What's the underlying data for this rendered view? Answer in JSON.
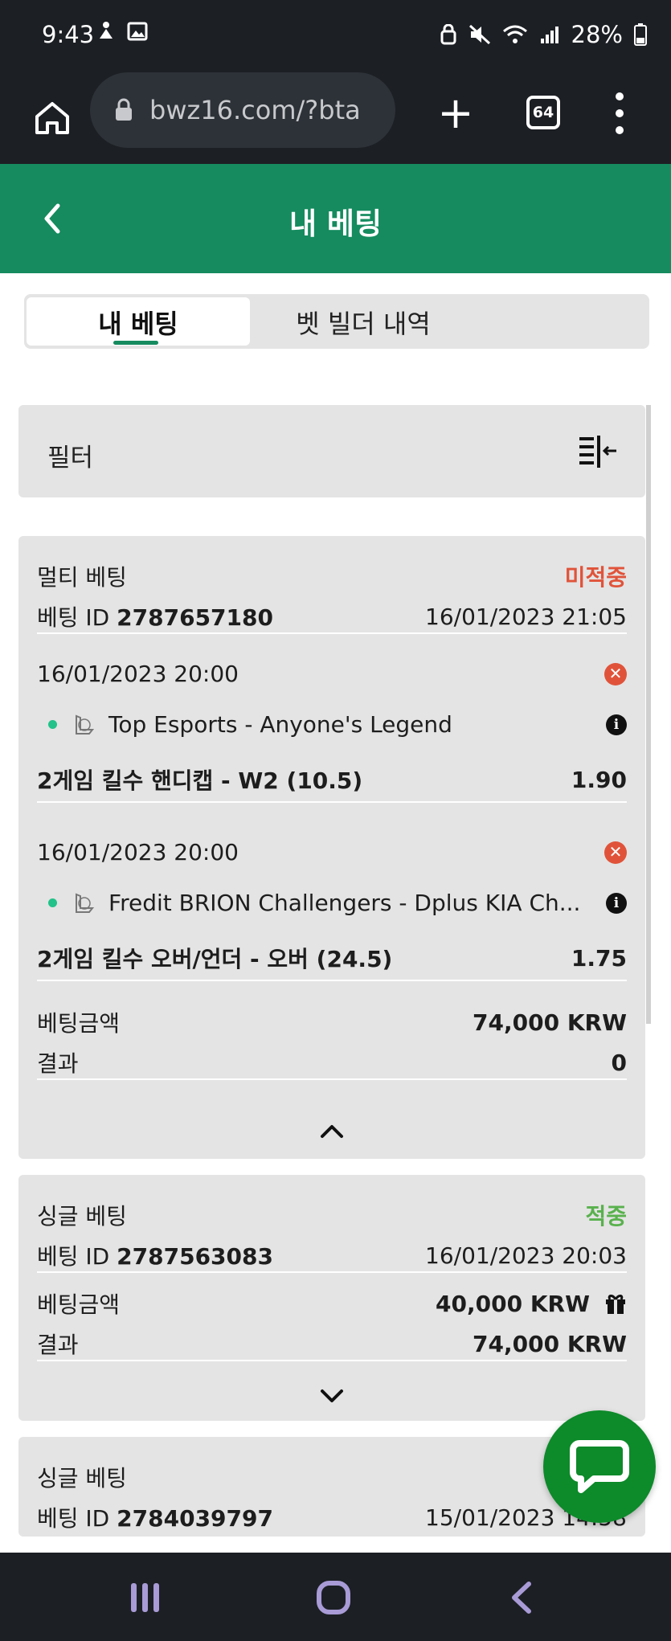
{
  "status_bar": {
    "time": "9:43",
    "battery": "28%"
  },
  "browser": {
    "url": "bwz16.com/?bta",
    "tab_count": "64"
  },
  "header": {
    "title": "내 베팅"
  },
  "segments": {
    "tab1": "내 베팅",
    "tab2": "벳 빌더 내역"
  },
  "filter": {
    "label": "필터"
  },
  "bets": [
    {
      "type": "멀티 베팅",
      "status": "미적중",
      "id_label": "베팅 ID",
      "id": "2787657180",
      "placed": "16/01/2023 21:05",
      "selections": [
        {
          "datetime": "16/01/2023 20:00",
          "match": "Top Esports - Anyone's Legend",
          "market": "2게임 킬수 핸디캡 - W2 (10.5)",
          "odds": "1.90"
        },
        {
          "datetime": "16/01/2023 20:00",
          "match": "Fredit BRION Challengers - Dplus KIA Ch...",
          "market": "2게임 킬수 오버/언더 - 오버 (24.5)",
          "odds": "1.75"
        }
      ],
      "stake_label": "베팅금액",
      "stake": "74,000 KRW",
      "result_label": "결과",
      "result": "0"
    },
    {
      "type": "싱글 베팅",
      "status": "적중",
      "id_label": "베팅 ID",
      "id": "2787563083",
      "placed": "16/01/2023 20:03",
      "stake_label": "베팅금액",
      "stake": "40,000 KRW",
      "result_label": "결과",
      "result": "74,000 KRW"
    },
    {
      "type": "싱글 베팅",
      "id_label": "베팅 ID",
      "id": "2784039797",
      "placed": "15/01/2023 14:58"
    }
  ],
  "colors": {
    "brand": "#158b5f",
    "lost": "#e0533a",
    "won": "#59b14d",
    "chat": "#0d8a2a"
  }
}
